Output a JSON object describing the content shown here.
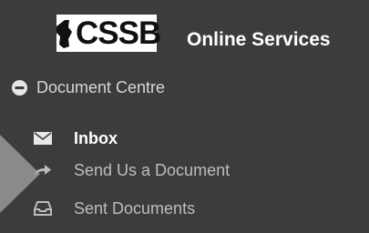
{
  "header": {
    "logo_text": "CSSB",
    "title": "Online Services"
  },
  "nav": {
    "section": {
      "label": "Document Centre",
      "icon": "minus-circle-icon"
    },
    "items": [
      {
        "label": "Inbox",
        "icon": "envelope-icon",
        "active": true
      },
      {
        "label": "Send Us a Document",
        "icon": "share-arrow-icon",
        "active": false
      },
      {
        "label": "Sent Documents",
        "icon": "tray-icon",
        "active": false
      }
    ]
  },
  "colors": {
    "background": "#3c3c3c",
    "text_active": "#ffffff",
    "text_muted": "#bdbdbd",
    "pointer": "#8a8a8a"
  }
}
